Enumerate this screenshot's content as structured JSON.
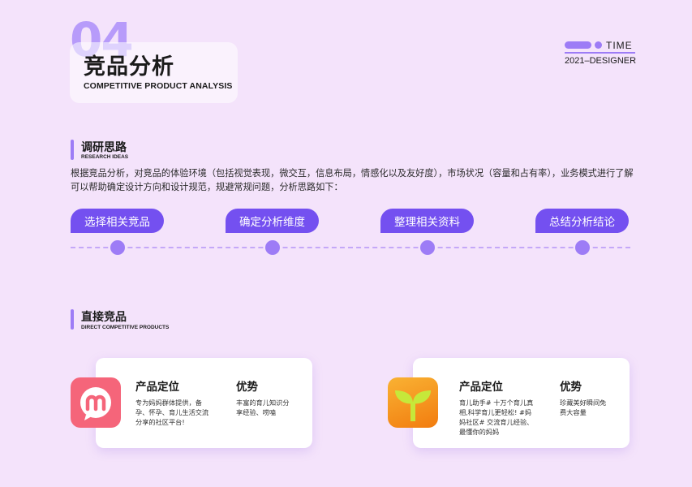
{
  "header": {
    "number": "04",
    "title": "竞品分析",
    "subtitle": "COMPETITIVE PRODUCT ANALYSIS",
    "time_label": "TIME",
    "designer": "2021–DESIGNER"
  },
  "research": {
    "title": "调研思路",
    "subtitle": "RESEARCH IDEAS",
    "description": "根据竞品分析，对竞品的体验环境（包括视觉表现，微交互，信息布局，情感化以及友好度），市场状况（容量和占有率），业务模式进行了解可以帮助确定设计方向和设计规范，规避常规问题，分析思路如下：",
    "steps": [
      "选择相关竞品",
      "确定分析维度",
      "整理相关资料",
      "总结分析结论"
    ]
  },
  "direct": {
    "title": "直接竞品",
    "subtitle": "DIRECT COMPETITIVE PRODUCTS",
    "products": [
      {
        "icon": "mama-app-icon",
        "position_label": "产品定位",
        "position_text": "专为妈妈群体提供，备孕、怀孕、育儿生活交流分享的社区平台!",
        "advantage_label": "优势",
        "advantage_text": "丰富的育儿知识分享经验、唠嗑"
      },
      {
        "icon": "sprout-app-icon",
        "position_label": "产品定位",
        "position_text": "育儿助手# 十万个育儿真相,科学育儿更轻松! #妈妈社区# 交流育儿经验、最懂你的妈妈",
        "advantage_label": "优势",
        "advantage_text": "珍藏美好瞬间免费大容量"
      }
    ]
  },
  "colors": {
    "background": "#f4e3fb",
    "accent": "#7450f0",
    "accent_light": "#9d7cf6",
    "icon1": "#f5657a",
    "icon2": "#f69a1c"
  }
}
